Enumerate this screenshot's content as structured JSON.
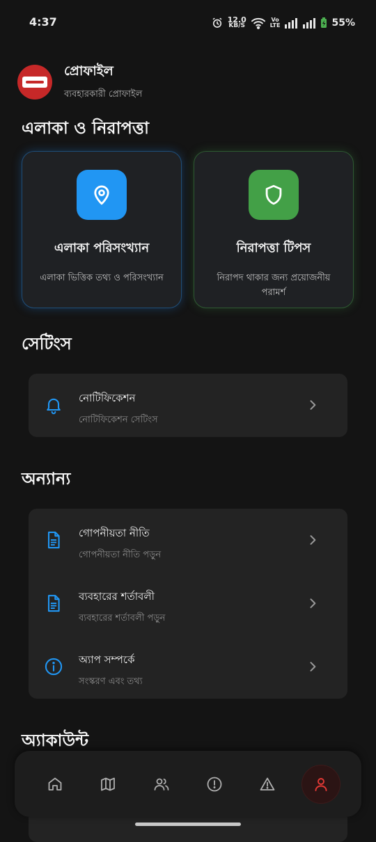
{
  "status_bar": {
    "time": "4:37",
    "net_speed_value": "12.0",
    "net_speed_unit": "KB/S",
    "volte_top": "Vo",
    "volte_bottom": "LTE",
    "battery": "55%"
  },
  "profile": {
    "title": "প্রোফাইল",
    "subtitle": "ব্যবহারকারী প্রোফাইল",
    "avatar_color": "#c62828"
  },
  "sections": {
    "area_safety": "এলাকা ও নিরাপত্তা",
    "settings": "সেটিংস",
    "others": "অন্যান্য",
    "account": "অ্যাকাউন্ট"
  },
  "cards": [
    {
      "title": "এলাকা পরিসংখ্যান",
      "desc": "এলাকা ভিত্তিক তথ্য ও পরিসংখ্যান",
      "icon": "location-pin-icon",
      "color": "#2196f3"
    },
    {
      "title": "নিরাপত্তা টিপস",
      "desc": "নিরাপদ থাকার জন্য প্রয়োজনীয় পরামর্শ",
      "icon": "shield-icon",
      "color": "#43a047"
    }
  ],
  "settings_items": [
    {
      "title": "নোটিফিকেশন",
      "subtitle": "নোটিফিকেশন সেটিংস",
      "icon": "bell-icon"
    }
  ],
  "other_items": [
    {
      "title": "গোপনীয়তা নীতি",
      "subtitle": "গোপনীয়তা নীতি পড়ুন",
      "icon": "document-icon"
    },
    {
      "title": "ব্যবহারের শর্তাবলী",
      "subtitle": "ব্যবহারের শর্তাবলী পড়ুন",
      "icon": "document-icon"
    },
    {
      "title": "অ্যাপ সম্পর্কে",
      "subtitle": "সংস্করণ এবং তথ্য",
      "icon": "info-icon"
    }
  ],
  "bottom_nav": [
    {
      "icon": "home-icon",
      "active": false
    },
    {
      "icon": "map-icon",
      "active": false
    },
    {
      "icon": "users-icon",
      "active": false
    },
    {
      "icon": "alert-circle-icon",
      "active": false
    },
    {
      "icon": "warning-triangle-icon",
      "active": false
    },
    {
      "icon": "user-icon",
      "active": true
    }
  ],
  "colors": {
    "accent_blue": "#2196f3",
    "accent_green": "#43a047",
    "active_red": "#e53935",
    "background": "#141414"
  }
}
